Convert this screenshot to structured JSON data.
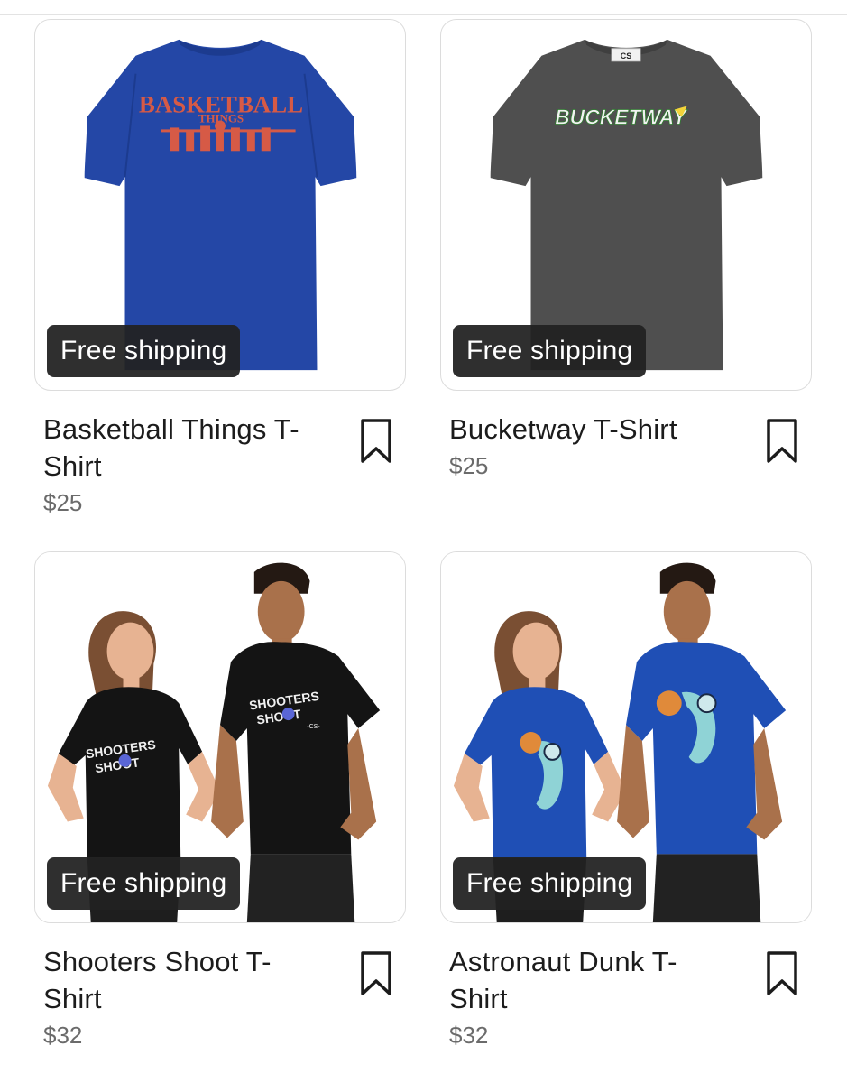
{
  "products": [
    {
      "title": "Basketball Things T-Shirt",
      "price": "$25",
      "badge": "Free shipping",
      "shirt_color": "#2447a6",
      "graphic_text_1": "BASKETBALL",
      "graphic_text_2": "THINGS",
      "save_icon": "bookmark-icon"
    },
    {
      "title": "Bucketway T-Shirt",
      "price": "$25",
      "badge": "Free shipping",
      "shirt_color": "#4f4f4f",
      "graphic_text_1": "BUCKETWAY",
      "neck_tag": "CS",
      "save_icon": "bookmark-icon"
    },
    {
      "title": "Shooters Shoot T-Shirt",
      "price": "$32",
      "badge": "Free shipping",
      "shirt_color": "#141414",
      "graphic_text_1": "SHOOTERS",
      "graphic_text_2": "SHOOT",
      "graphic_text_3": "-CS-",
      "save_icon": "bookmark-icon"
    },
    {
      "title": "Astronaut Dunk T-Shirt",
      "price": "$32",
      "badge": "Free shipping",
      "shirt_color": "#1f4fb5",
      "save_icon": "bookmark-icon"
    }
  ]
}
